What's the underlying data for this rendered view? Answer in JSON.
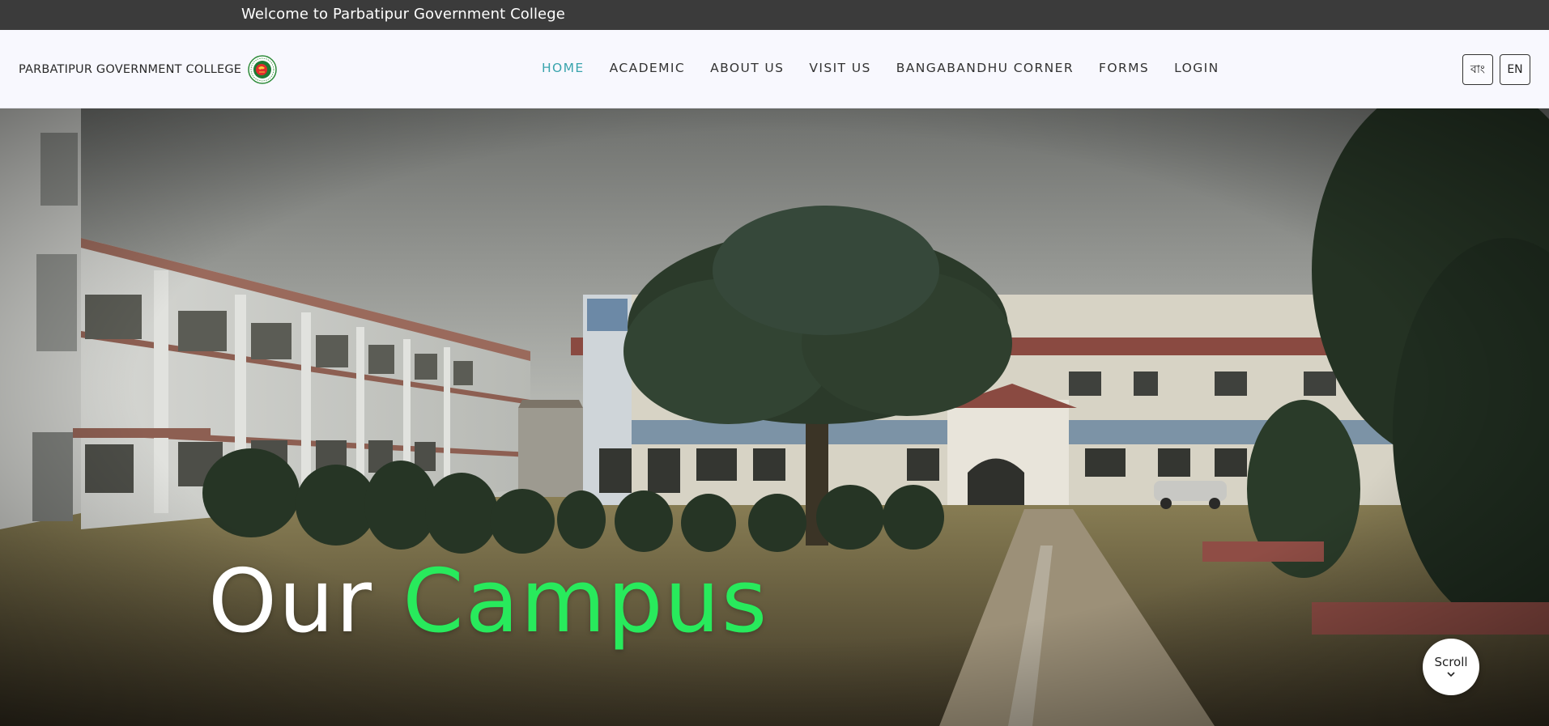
{
  "topbar": {
    "welcome": "Welcome to Parbatipur Government College"
  },
  "header": {
    "brand_name": "PARBATIPUR GOVERNMENT COLLEGE",
    "logo_icon": "bangladesh-emblem-icon",
    "nav": [
      {
        "label": "HOME",
        "active": true
      },
      {
        "label": "ACADEMIC",
        "active": false
      },
      {
        "label": "ABOUT US",
        "active": false
      },
      {
        "label": "VISIT US",
        "active": false
      },
      {
        "label": "BANGABANDHU CORNER",
        "active": false
      },
      {
        "label": "FORMS",
        "active": false
      },
      {
        "label": "LOGIN",
        "active": false
      }
    ],
    "languages": [
      "বাং",
      "EN"
    ]
  },
  "hero": {
    "title_word1": "Our",
    "title_word2": "Campus",
    "scroll_label": "Scroll",
    "scroll_icon": "chevron-down-icon",
    "image": "campus-photo"
  },
  "colors": {
    "topbar_bg": "#3b3b3b",
    "nav_active": "#3aa4ad",
    "hero_accent": "#28ea5c",
    "header_bg": "#f8f8fe"
  }
}
